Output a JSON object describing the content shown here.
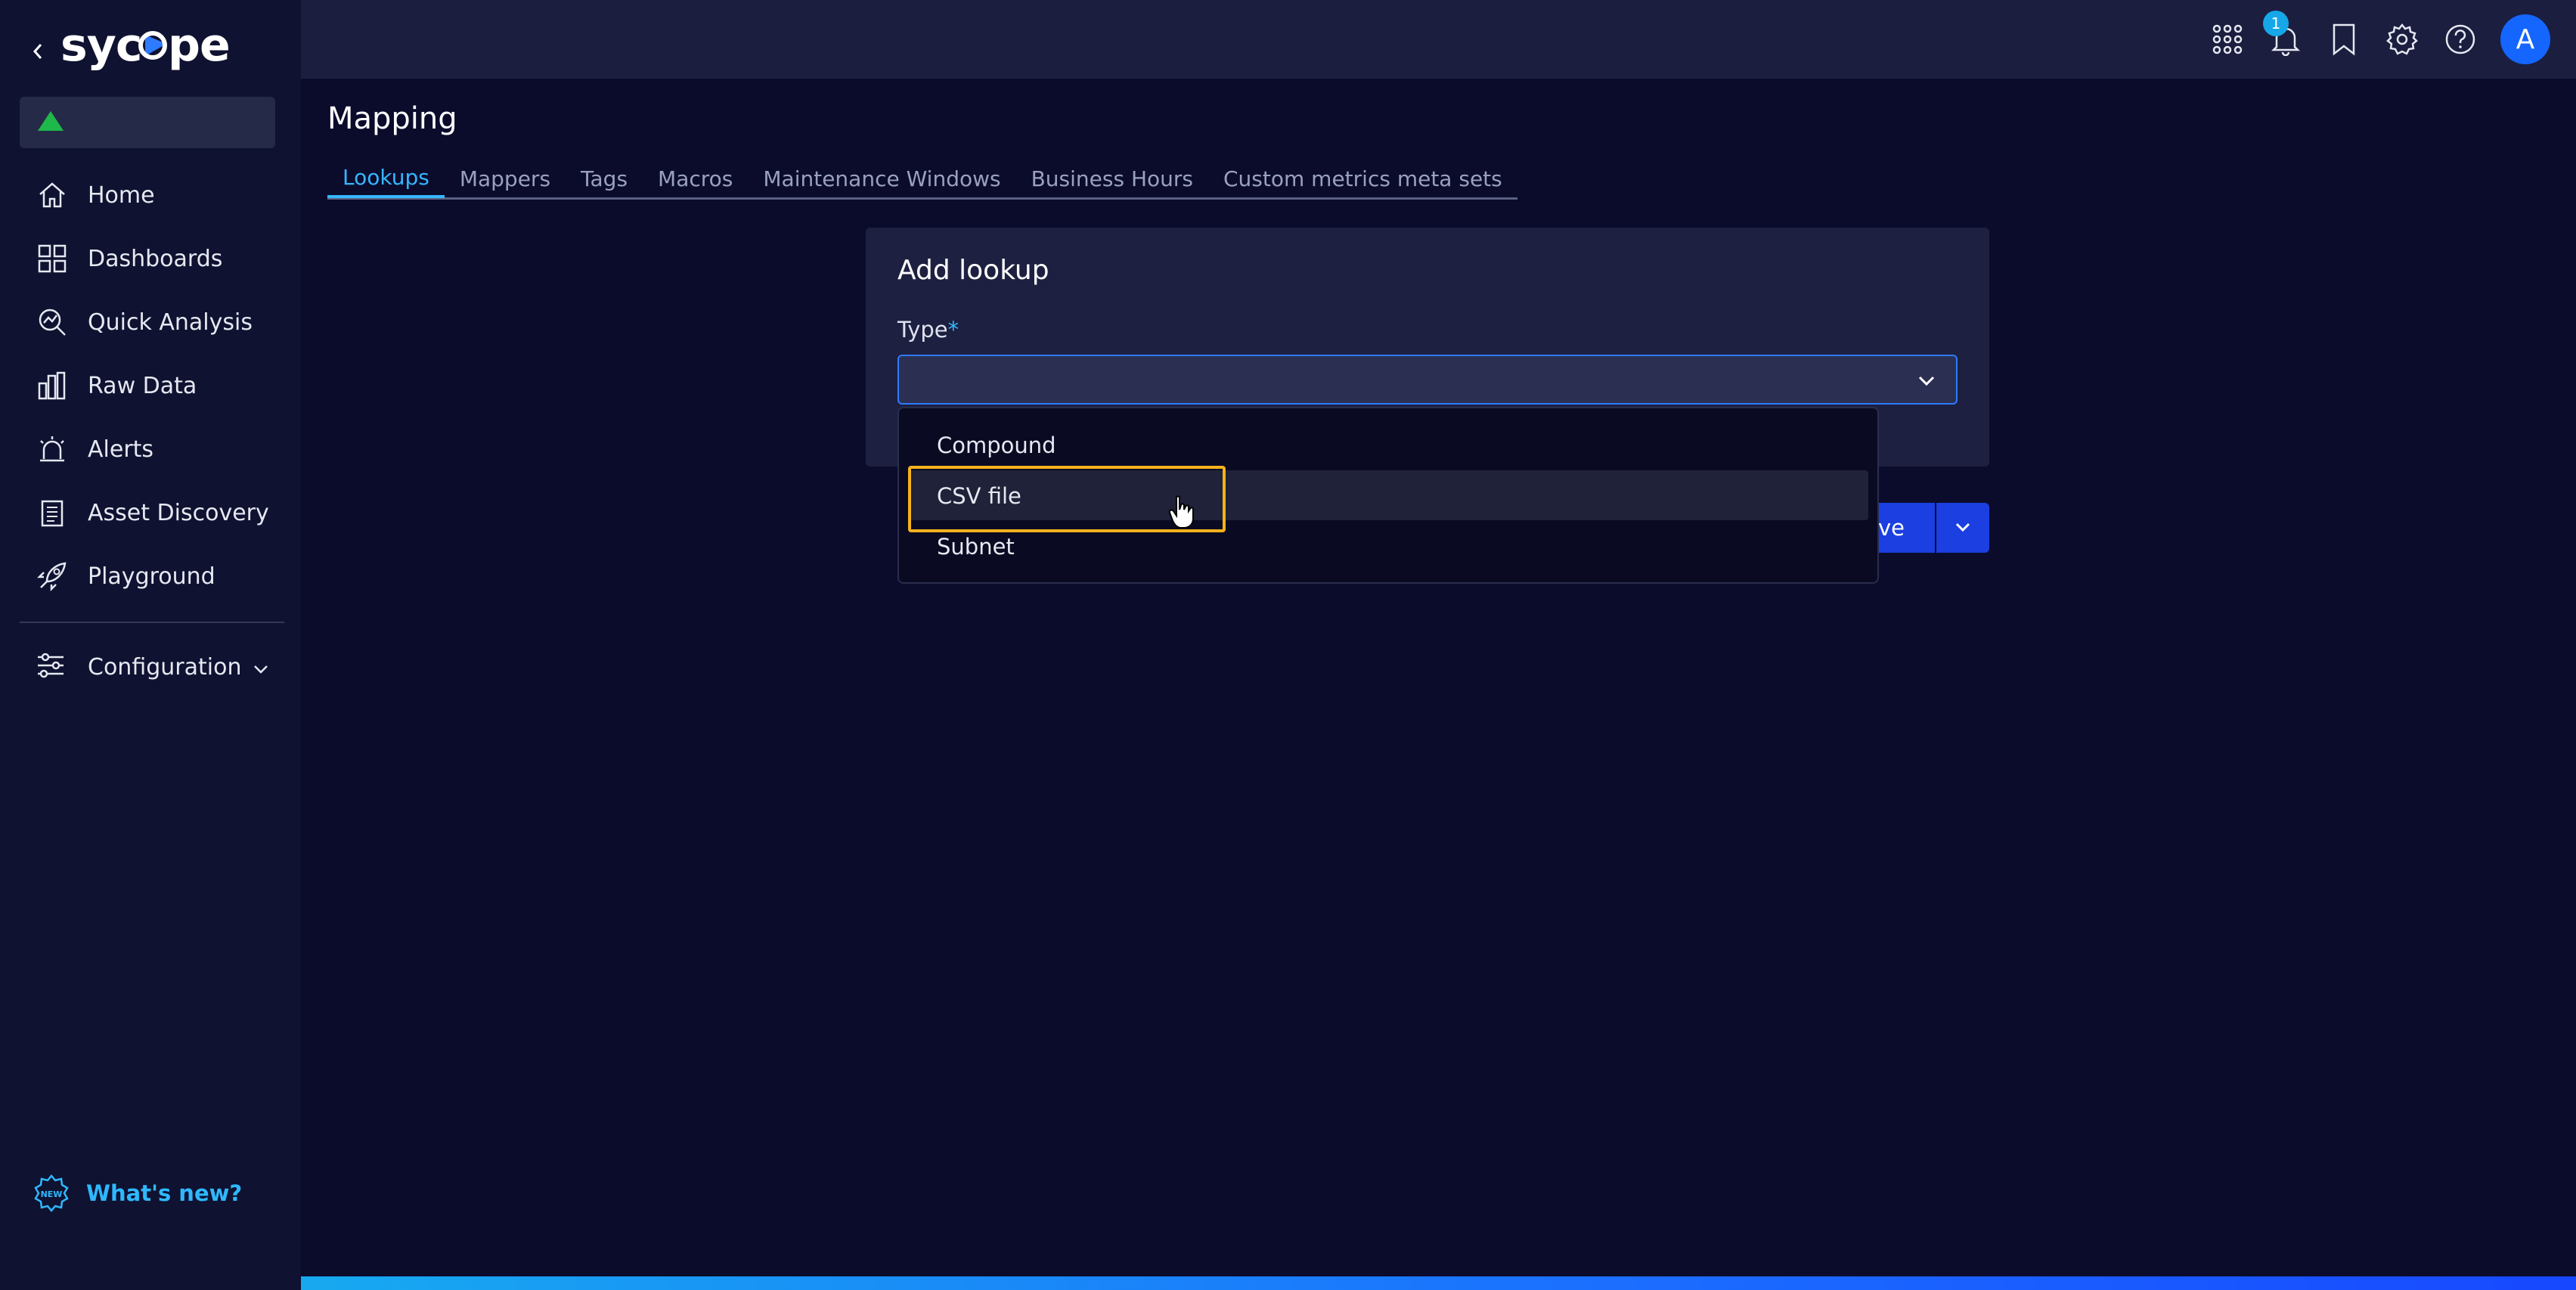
{
  "app": {
    "logo_text": "sycope",
    "back_label": "‹"
  },
  "sidebar": {
    "items": [
      {
        "label": "Home",
        "icon": "home-icon"
      },
      {
        "label": "Dashboards",
        "icon": "dashboard-grid-icon"
      },
      {
        "label": "Quick Analysis",
        "icon": "quick-analysis-icon"
      },
      {
        "label": "Raw Data",
        "icon": "bar-chart-icon"
      },
      {
        "label": "Alerts",
        "icon": "alarm-icon"
      },
      {
        "label": "Asset Discovery",
        "icon": "clipboard-icon"
      },
      {
        "label": "Playground",
        "icon": "rocket-icon"
      }
    ],
    "configuration": {
      "label": "Configuration",
      "icon": "sliders-icon"
    },
    "whats_new": {
      "label": "What's new?",
      "icon": "new-badge-icon"
    },
    "status_icon": "green-triangle-icon"
  },
  "topbar": {
    "notification_count": "1",
    "avatar_initial": "A",
    "icons": [
      "apps-grid-icon",
      "bell-icon",
      "bookmark-icon",
      "gear-icon",
      "help-icon"
    ]
  },
  "page": {
    "title": "Mapping",
    "tabs": [
      {
        "label": "Lookups",
        "active": true
      },
      {
        "label": "Mappers",
        "active": false
      },
      {
        "label": "Tags",
        "active": false
      },
      {
        "label": "Macros",
        "active": false
      },
      {
        "label": "Maintenance Windows",
        "active": false
      },
      {
        "label": "Business Hours",
        "active": false
      },
      {
        "label": "Custom metrics meta sets",
        "active": false
      }
    ]
  },
  "form": {
    "title": "Add lookup",
    "type_label": "Type",
    "required_marker": "*",
    "type_value": "",
    "save_label": "ve"
  },
  "dropdown": {
    "options": [
      "Compound",
      "CSV file",
      "Subnet"
    ],
    "highlighted": "CSV file"
  },
  "colors": {
    "accent": "#36b6ff",
    "primary_button": "#1b3fe0",
    "focus_outline": "#f5b21b",
    "status_ok": "#1fb84a"
  }
}
